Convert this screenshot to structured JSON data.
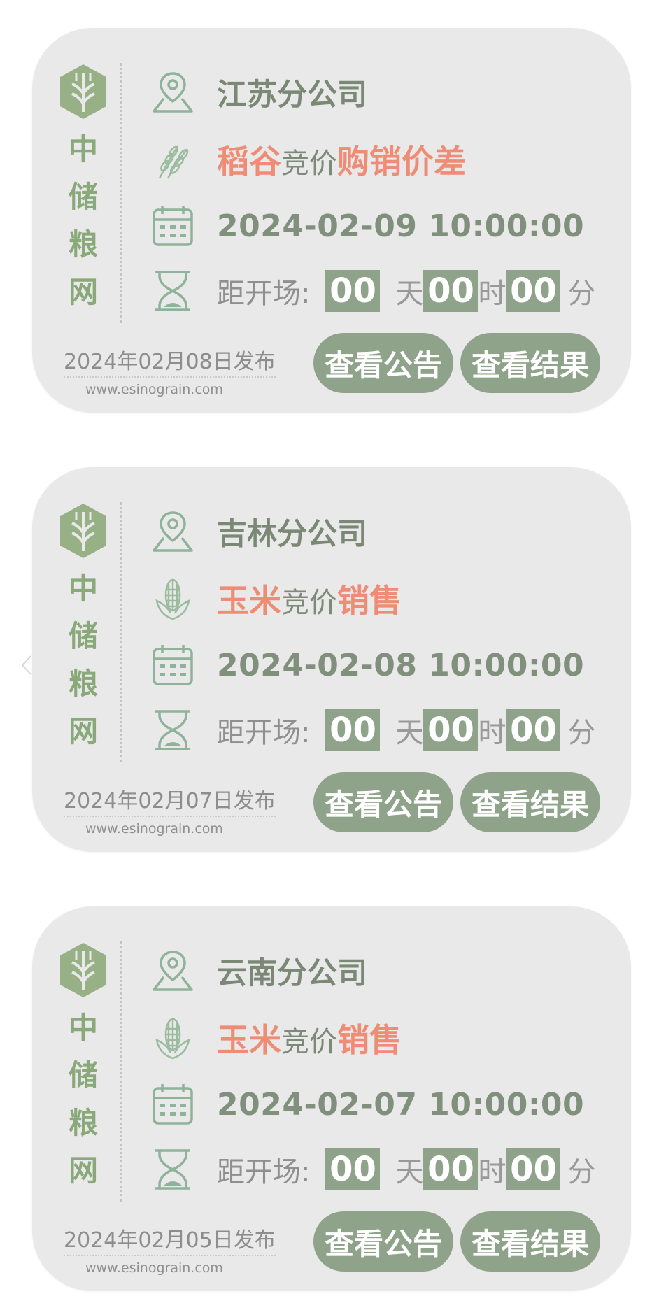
{
  "brand": {
    "chars": [
      "中",
      "储",
      "粮",
      "网"
    ],
    "site": "www.esinograin.com"
  },
  "colors": {
    "card_bg": "#e9e9e9",
    "accent_green": "#8ea38a",
    "brand_green": "#8aa97a",
    "highlight_orange": "#ef8c76"
  },
  "countdown_labels": {
    "label": "距开场:",
    "day": "天",
    "hour": "时",
    "minute": "分"
  },
  "buttons": {
    "notice": "查看公告",
    "result": "查看结果"
  },
  "cards": [
    {
      "company": "江苏分公司",
      "product_icon": "wheat-icon",
      "title_parts": [
        "稻谷",
        "竞价",
        "购销价差"
      ],
      "datetime": "2024-02-09 10:00:00",
      "countdown": {
        "days": "00",
        "hours": "00",
        "minutes": "00"
      },
      "published": "2024年02月08日发布"
    },
    {
      "company": "吉林分公司",
      "product_icon": "corn-icon",
      "title_parts": [
        "玉米",
        "竞价",
        "销售"
      ],
      "datetime": "2024-02-08 10:00:00",
      "countdown": {
        "days": "00",
        "hours": "00",
        "minutes": "00"
      },
      "published": "2024年02月07日发布"
    },
    {
      "company": "云南分公司",
      "product_icon": "corn-icon",
      "title_parts": [
        "玉米",
        "竞价",
        "销售"
      ],
      "datetime": "2024-02-07 10:00:00",
      "countdown": {
        "days": "00",
        "hours": "00",
        "minutes": "00"
      },
      "published": "2024年02月05日发布"
    }
  ]
}
